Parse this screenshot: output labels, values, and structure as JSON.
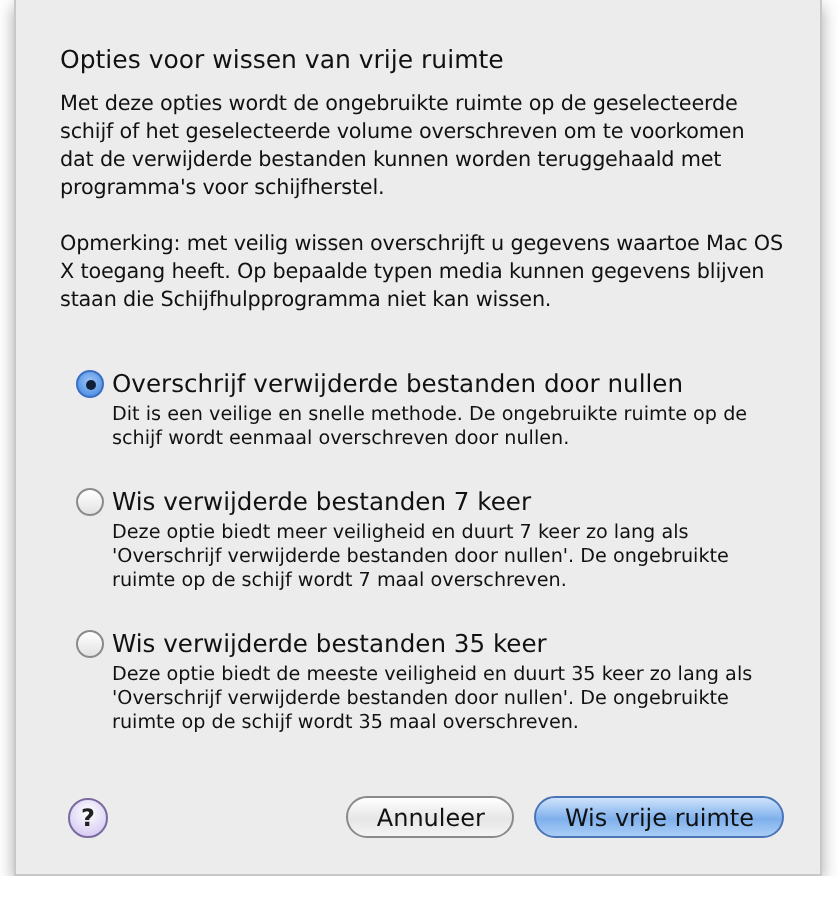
{
  "title": "Opties voor wissen van vrije ruimte",
  "paragraphs": [
    "Met deze opties wordt de ongebruikte ruimte op de geselecteerde schijf of het geselecteerde volume overschreven om te voorkomen dat de verwijderde bestanden kunnen worden teruggehaald met programma's voor schijfherstel.",
    "Opmerking: met veilig wissen overschrijft u gegevens waartoe Mac OS X toegang heeft. Op bepaalde typen media kunnen gegevens blijven staan die Schijfhulpprogramma niet kan wissen."
  ],
  "options": [
    {
      "label": "Overschrijf verwijderde bestanden door nullen",
      "description": "Dit is een veilige en snelle methode. De ongebruikte ruimte op de schijf wordt eenmaal overschreven door nullen.",
      "selected": true
    },
    {
      "label": "Wis verwijderde bestanden 7 keer",
      "description": "Deze optie biedt meer veiligheid en duurt 7 keer zo lang als 'Overschrijf verwijderde bestanden door nullen'. De ongebruikte ruimte op de schijf wordt 7 maal overschreven.",
      "selected": false
    },
    {
      "label": "Wis verwijderde bestanden 35 keer",
      "description": "Deze optie biedt de meeste veiligheid en duurt 35 keer zo lang als 'Overschrijf verwijderde bestanden door nullen'. De ongebruikte ruimte op de schijf wordt 35 maal overschreven.",
      "selected": false
    }
  ],
  "help": "?",
  "buttons": [
    {
      "label": "Annuleer",
      "kind": "secondary"
    },
    {
      "label": "Wis vrije ruimte",
      "kind": "default"
    }
  ]
}
